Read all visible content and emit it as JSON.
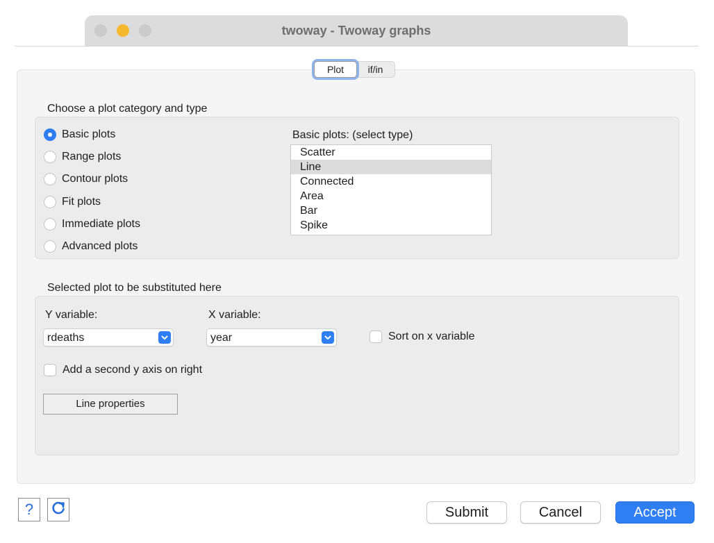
{
  "window": {
    "title": "twoway - Twoway graphs"
  },
  "tabs": [
    {
      "label": "Plot",
      "selected": true
    },
    {
      "label": "if/in",
      "selected": false
    }
  ],
  "plot_category": {
    "heading": "Choose a plot category and type",
    "options": [
      {
        "label": "Basic plots",
        "checked": true
      },
      {
        "label": "Range plots",
        "checked": false
      },
      {
        "label": "Contour plots",
        "checked": false
      },
      {
        "label": "Fit plots",
        "checked": false
      },
      {
        "label": "Immediate plots",
        "checked": false
      },
      {
        "label": "Advanced plots",
        "checked": false
      }
    ],
    "type_list_label": "Basic plots: (select type)",
    "types": [
      {
        "label": "Scatter",
        "selected": false
      },
      {
        "label": "Line",
        "selected": true
      },
      {
        "label": "Connected",
        "selected": false
      },
      {
        "label": "Area",
        "selected": false
      },
      {
        "label": "Bar",
        "selected": false
      },
      {
        "label": "Spike",
        "selected": false
      }
    ]
  },
  "substitution": {
    "heading": "Selected plot to be substituted here",
    "y_label": "Y variable:",
    "y_value": "rdeaths",
    "x_label": "X variable:",
    "x_value": "year",
    "sort_label": "Sort on x variable",
    "sort_checked": false,
    "second_axis_label": "Add a second y axis on right",
    "second_axis_checked": false,
    "line_properties_label": "Line properties"
  },
  "footer": {
    "help_label": "?",
    "submit_label": "Submit",
    "cancel_label": "Cancel",
    "accept_label": "Accept"
  },
  "colors": {
    "accent": "#2f7ef3",
    "minimize": "#f5b82e"
  }
}
